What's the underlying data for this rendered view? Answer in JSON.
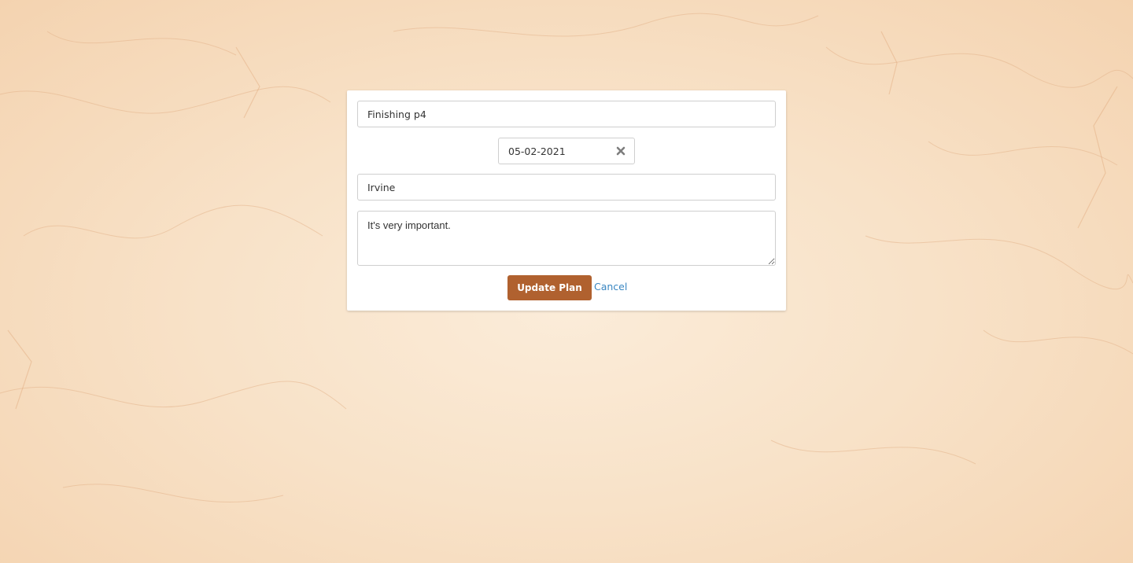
{
  "form": {
    "title_value": "Finishing p4",
    "date_value": "05-02-2021",
    "location_value": "Irvine",
    "notes_value": "It's very important.",
    "submit_label": "Update Plan",
    "cancel_label": "Cancel",
    "clear_icon": "close-x-icon"
  },
  "colors": {
    "background": "#f8e2c8",
    "button": "#b0612f",
    "link": "#3a87c2"
  }
}
